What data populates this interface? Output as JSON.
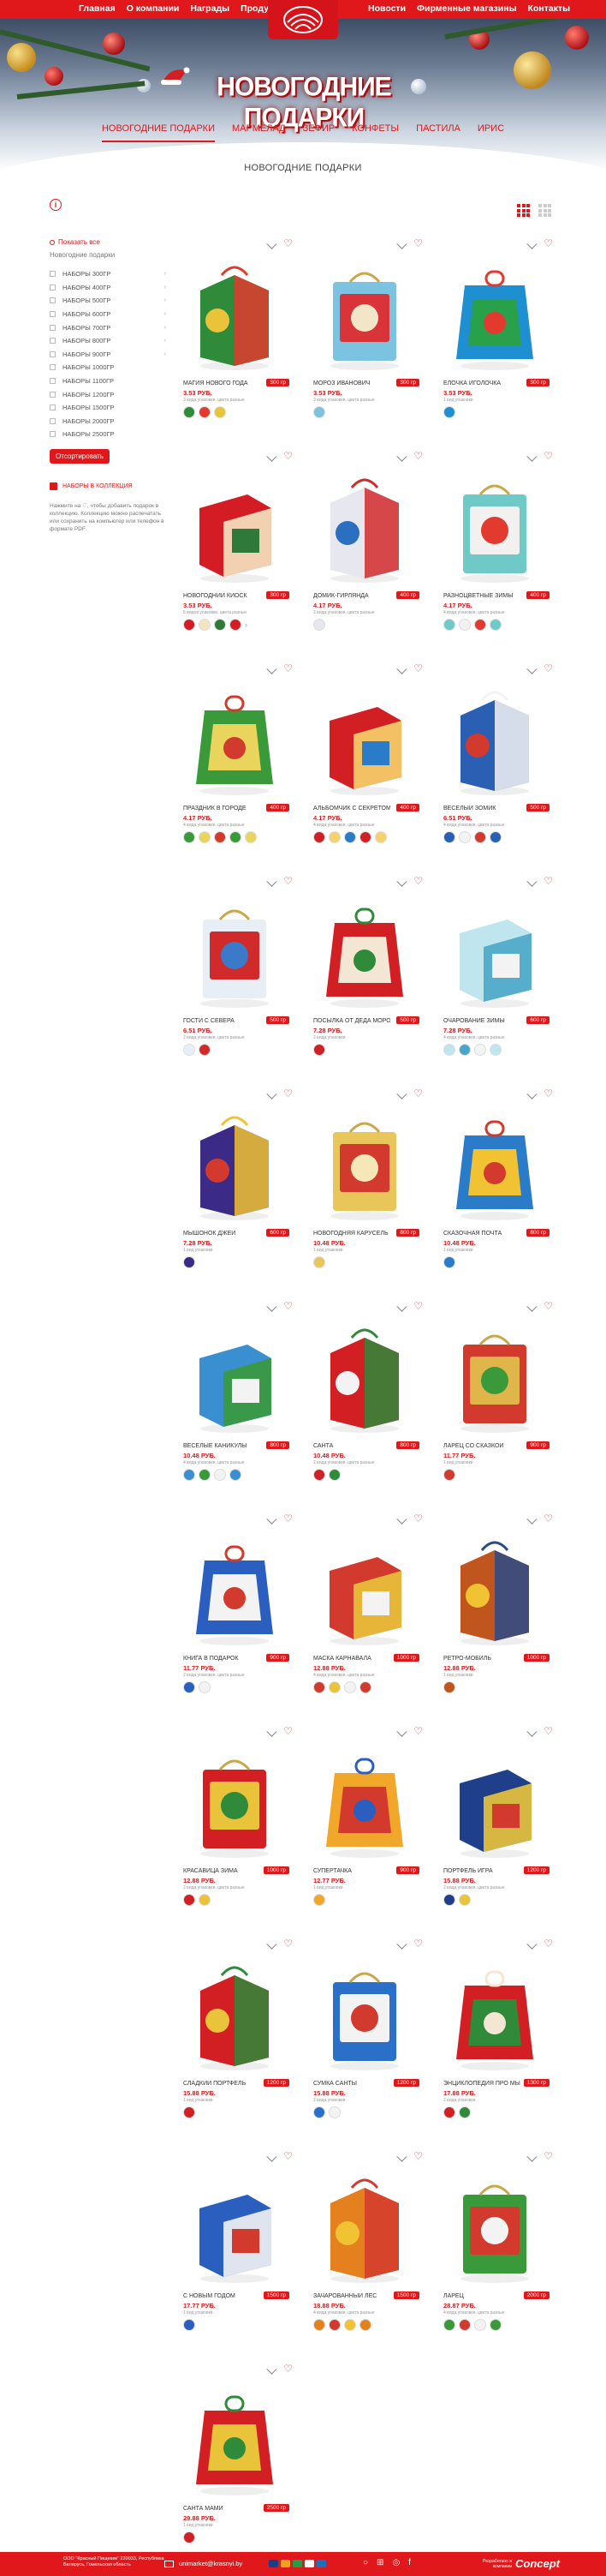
{
  "topnav": {
    "left": [
      "Главная",
      "О компании",
      "Награды",
      "Продукция"
    ],
    "right": [
      "Новости",
      "Фирменные магазины",
      "Контакты"
    ]
  },
  "hero": {
    "title": "НОВОГОДНИЕ ПОДАРКИ"
  },
  "catnav": [
    "НОВОГОДНИЕ ПОДАРКИ",
    "МАРМЕЛАД",
    "ЗЕФИР",
    "КОНФЕТЫ",
    "ПАСТИЛА",
    "ИРИС"
  ],
  "page_title": "НОВОГОДНИЕ ПОДАРКИ",
  "sidebar": {
    "show_all": "Показать все",
    "filter_title": "Новогодние подарки",
    "filters": [
      "НАБОРЫ 300ГР",
      "НАБОРЫ 400ГР",
      "НАБОРЫ 500ГР",
      "НАБОРЫ 600ГР",
      "НАБОРЫ 700ГР",
      "НАБОРЫ 800ГР",
      "НАБОРЫ 900ГР",
      "НАБОРЫ 1000ГР",
      "НАБОРЫ 1100ГР",
      "НАБОРЫ 1200ГР",
      "НАБОРЫ 1500ГР",
      "НАБОРЫ 2000ГР",
      "НАБОРЫ 2500ГР"
    ],
    "sort_button": "Отсортировать",
    "collection_title": "НАБОРЫ В КОЛЛЕКЦИЯ",
    "collection_desc": "Нажмите на ♡, чтобы добавить подарок в коллекцию. Коллекцию можно распечатать или сохранить на компьютер или телефон в формате PDF."
  },
  "products": [
    {
      "name": "МАГИЯ НОВОГО ГОДА",
      "weight": "300 гр",
      "price": "3.53 РУБ.",
      "note": "3 вида упаковки, цвета разные",
      "colors": [
        "#2f8a3a",
        "#e23a2e",
        "#e9c43a"
      ],
      "thumbs": 3
    },
    {
      "name": "МОРОЗ ИВАНОВИЧ",
      "weight": "300 гр",
      "price": "3.53 РУБ.",
      "note": "3 вида упаковки, цвета разные",
      "colors": [
        "#7bc3e0",
        "#d8343a",
        "#f2e5c8"
      ],
      "thumbs": 1
    },
    {
      "name": "ЁЛОЧКА ИГОЛОЧКА",
      "weight": "300 гр",
      "price": "3.53 РУБ.",
      "note": "1 вид упаковки",
      "colors": [
        "#1e8fd0",
        "#29a14a",
        "#e23a2e"
      ],
      "thumbs": 1
    },
    {
      "name": "НОВОГОДНИЙ КИОСК",
      "weight": "300 гр",
      "price": "3.53 РУБ.",
      "note": "5 видов упаковки, цвета разные",
      "colors": [
        "#d31c24",
        "#f5e4c2",
        "#2f7a3a"
      ],
      "thumbs": 4,
      "more": true
    },
    {
      "name": "ДОМИК-ГИРЛЯНДА",
      "weight": "400 гр",
      "price": "4.17 РУБ.",
      "note": "2 вида упаковки, цвета разные",
      "colors": [
        "#e7e7ef",
        "#d12a2a",
        "#2b6fc0"
      ],
      "thumbs": 1
    },
    {
      "name": "РАЗНОЦВЕТНЫЕ ЗИМЫ",
      "weight": "400 гр",
      "price": "4.17 РУБ.",
      "note": "4 вида упаковки, цвета разные",
      "colors": [
        "#6fc9c6",
        "#f3f1f0",
        "#e23a2e"
      ],
      "thumbs": 4
    },
    {
      "name": "ПРАЗДНИК В ГОРОДЕ",
      "weight": "400 гр",
      "price": "4.17 РУБ.",
      "note": "4 вида упаковки, цвета разные",
      "colors": [
        "#3a9a3a",
        "#e9d55c",
        "#d23a2e"
      ],
      "thumbs": 5
    },
    {
      "name": "АЛЬБОМЧИК С СЕКРЕТОМ",
      "weight": "400 гр",
      "price": "4.17 РУБ.",
      "note": "4 вида упаковки, цвета разные",
      "colors": [
        "#d21f24",
        "#f6d26c",
        "#2a7bc8"
      ],
      "thumbs": 5
    },
    {
      "name": "ВЕСЁЛЫЙ ЗОМИК",
      "weight": "500 гр",
      "price": "6.51 РУБ.",
      "note": "4 вида упаковки, цвета разные",
      "colors": [
        "#2a5fb4",
        "#f3f3f3",
        "#d23a2e"
      ],
      "thumbs": 4
    },
    {
      "name": "ГОСТИ С СЕВЕРА",
      "weight": "500 гр",
      "price": "6.51 РУБ.",
      "note": "2 вида упаковки, цвета разные",
      "colors": [
        "#e8eef5",
        "#d12a2a",
        "#3a7ac8"
      ],
      "thumbs": 2
    },
    {
      "name": "ПОСЫЛКА ОТ ДЕДА МОРОЗА",
      "weight": "500 гр",
      "price": "7.28 РУБ.",
      "note": "2 вида упаковки",
      "colors": [
        "#d21f24",
        "#f3e7d3",
        "#2f8a3a"
      ],
      "thumbs": 1
    },
    {
      "name": "ОЧАРОВАНИЕ ЗИМЫ",
      "weight": "600 гр",
      "price": "7.28 РУБ.",
      "note": "4 вида упаковки, цвета разные",
      "colors": [
        "#bfe5ee",
        "#4aa6c8",
        "#f3f3f3"
      ],
      "thumbs": 4
    },
    {
      "name": "МЫШОНОК ДЖЕЙ",
      "weight": "600 гр",
      "price": "7.28 РУБ.",
      "note": "1 вид упаковки",
      "colors": [
        "#3b2a86",
        "#f1c232",
        "#d23a2e"
      ],
      "thumbs": 1
    },
    {
      "name": "НОВОГОДНЯЯ КАРУСЕЛЬ",
      "weight": "800 гр",
      "price": "10.48 РУБ.",
      "note": "1 вид упаковки",
      "colors": [
        "#e8c65a",
        "#d23a2e",
        "#f5e7b8"
      ],
      "thumbs": 1
    },
    {
      "name": "СКАЗОЧНАЯ ПОЧТА",
      "weight": "800 гр",
      "price": "10.48 РУБ.",
      "note": "1 вид упаковки",
      "colors": [
        "#2a7bc8",
        "#f1c232",
        "#d23a2e"
      ],
      "thumbs": 1
    },
    {
      "name": "ВЕСЁЛЫЕ КАНИКУЛЫ",
      "weight": "800 гр",
      "price": "10.48 РУБ.",
      "note": "4 вида упаковки, цвета разные",
      "colors": [
        "#3a8fd0",
        "#3a9a3a",
        "#f3f3f3"
      ],
      "thumbs": 4
    },
    {
      "name": "САНТА",
      "weight": "800 гр",
      "price": "10.48 РУБ.",
      "note": "2 вида упаковки, цвета разные",
      "colors": [
        "#d21f24",
        "#2f8a3a",
        "#f3f3f3"
      ],
      "thumbs": 2
    },
    {
      "name": "ЛАРЕЦ СО СКАЗКОЙ",
      "weight": "900 гр",
      "price": "11.77 РУБ.",
      "note": "1 вид упаковки",
      "colors": [
        "#d23a2e",
        "#e0b64a",
        "#3a9a3a"
      ],
      "thumbs": 1
    },
    {
      "name": "КНИГА В ПОДАРОК",
      "weight": "900 гр",
      "price": "11.77 РУБ.",
      "note": "2 вида упаковки, цвета разные",
      "colors": [
        "#2a5fc0",
        "#f3f3f3",
        "#d23a2e"
      ],
      "thumbs": 2
    },
    {
      "name": "МАСКА КАРНАВАЛА",
      "weight": "1000 гр",
      "price": "12.88 РУБ.",
      "note": "4 вида упаковки, цвета разные",
      "colors": [
        "#d23a2e",
        "#e9c43a",
        "#f3f3f3"
      ],
      "thumbs": 4
    },
    {
      "name": "РЕТРО-МОБИЛЬ",
      "weight": "1000 гр",
      "price": "12.88 РУБ.",
      "note": "1 вид упаковки",
      "colors": [
        "#c1551e",
        "#2a4b8a",
        "#f1c232"
      ],
      "thumbs": 1
    },
    {
      "name": "КРАСАВИЦА ЗИМА",
      "weight": "1000 гр",
      "price": "12.88 РУБ.",
      "note": "2 вида упаковки, цвета разные",
      "colors": [
        "#d21f24",
        "#e9c43a",
        "#2f8a3a"
      ],
      "thumbs": 2
    },
    {
      "name": "СУПЕРТАЧКА",
      "weight": "900 гр",
      "price": "12.77 РУБ.",
      "note": "1 вид упаковки",
      "colors": [
        "#f1a82a",
        "#d23a2e",
        "#2a5fc0"
      ],
      "thumbs": 1
    },
    {
      "name": "ПОРТФЕЛЬ ИГРА",
      "weight": "1200 гр",
      "price": "15.88 РУБ.",
      "note": "2 вида упаковки, цвета разные",
      "colors": [
        "#1f3f8a",
        "#e9c43a",
        "#d23a2e"
      ],
      "thumbs": 2
    },
    {
      "name": "СЛАДКИЙ ПОРТФЕЛЬ",
      "weight": "1200 гр",
      "price": "15.88 РУБ.",
      "note": "1 вид упаковки",
      "colors": [
        "#d21f24",
        "#2f8a3a",
        "#e9c43a"
      ],
      "thumbs": 1
    },
    {
      "name": "СУМКА САНТЫ",
      "weight": "1200 гр",
      "price": "15.88 РУБ.",
      "note": "2 вида упаковки",
      "colors": [
        "#2a6fc8",
        "#f3f3f3",
        "#d23a2e"
      ],
      "thumbs": 2
    },
    {
      "name": "ЭНЦИКЛОПЕДИЯ ПРО МЫШАТ",
      "weight": "1300 гр",
      "price": "17.88 РУБ.",
      "note": "2 вида упаковки",
      "colors": [
        "#d21f24",
        "#2f8a3a",
        "#f3e7d3"
      ],
      "thumbs": 2
    },
    {
      "name": "С НОВЫМ ГОДОМ",
      "weight": "1500 гр",
      "price": "17.77 РУБ.",
      "note": "1 вид упаковки",
      "colors": [
        "#2a5fc0",
        "#f3f3f3",
        "#d23a2e"
      ],
      "thumbs": 1
    },
    {
      "name": "ЗАЧАРОВАННЫЙ ЛЕС",
      "weight": "1500 гр",
      "price": "18.88 РУБ.",
      "note": "4 вида упаковки, цвета разные",
      "colors": [
        "#e4801e",
        "#d23a2e",
        "#f1c232"
      ],
      "thumbs": 4
    },
    {
      "name": "ЛАРЕЦ",
      "weight": "2000 гр",
      "price": "28.87 РУБ.",
      "note": "4 вида упаковки, цвета разные",
      "colors": [
        "#3a9a3a",
        "#d23a2e",
        "#f3f3f3"
      ],
      "thumbs": 4
    },
    {
      "name": "САНТА МАМИ",
      "weight": "2500 гр",
      "price": "29.88 РУБ.",
      "note": "1 вид упаковки",
      "colors": [
        "#d21f24",
        "#e9c43a",
        "#2f8a3a"
      ],
      "thumbs": 1
    }
  ],
  "footer": {
    "company": "ООО \"Красный Пищевик\" 220033, Республика Беларусь, Гомельская область",
    "email": "unimarket@krasnyi.by",
    "developer": "Разработано в компании",
    "brand": "Concept"
  },
  "colors": {
    "accent": "#e0181b"
  }
}
